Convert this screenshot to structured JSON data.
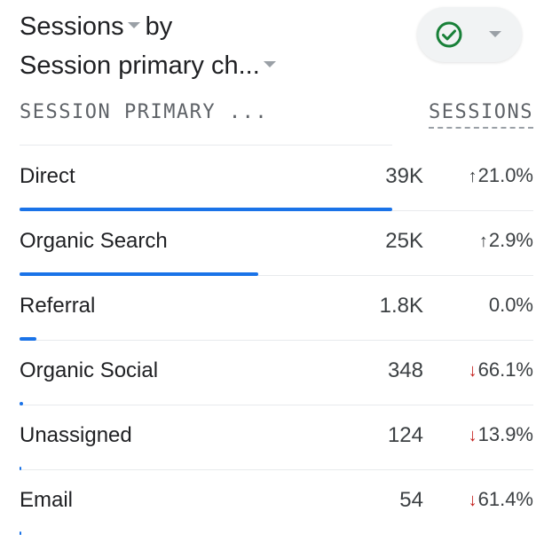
{
  "card": {
    "metric_label": "Sessions",
    "by_label": "by",
    "dimension_label": "Session primary ch...",
    "status_icon": "check-circle-icon",
    "accent_color": "#1a73e8",
    "down_color": "#c5221f"
  },
  "table": {
    "col_dimension": "SESSION PRIMARY ...",
    "col_metric": "SESSIONS",
    "rows": [
      {
        "name": "Direct",
        "sessions": "39K",
        "change": "21.0%",
        "direction": "up",
        "bar_fraction": 1.0
      },
      {
        "name": "Organic Search",
        "sessions": "25K",
        "change": "2.9%",
        "direction": "up",
        "bar_fraction": 0.64
      },
      {
        "name": "Referral",
        "sessions": "1.8K",
        "change": "0.0%",
        "direction": "none",
        "bar_fraction": 0.046
      },
      {
        "name": "Organic Social",
        "sessions": "348",
        "change": "66.1%",
        "direction": "down",
        "bar_fraction": 0.009
      },
      {
        "name": "Unassigned",
        "sessions": "124",
        "change": "13.9%",
        "direction": "down",
        "bar_fraction": 0.003
      },
      {
        "name": "Email",
        "sessions": "54",
        "change": "61.4%",
        "direction": "down",
        "bar_fraction": 0.001
      }
    ]
  }
}
